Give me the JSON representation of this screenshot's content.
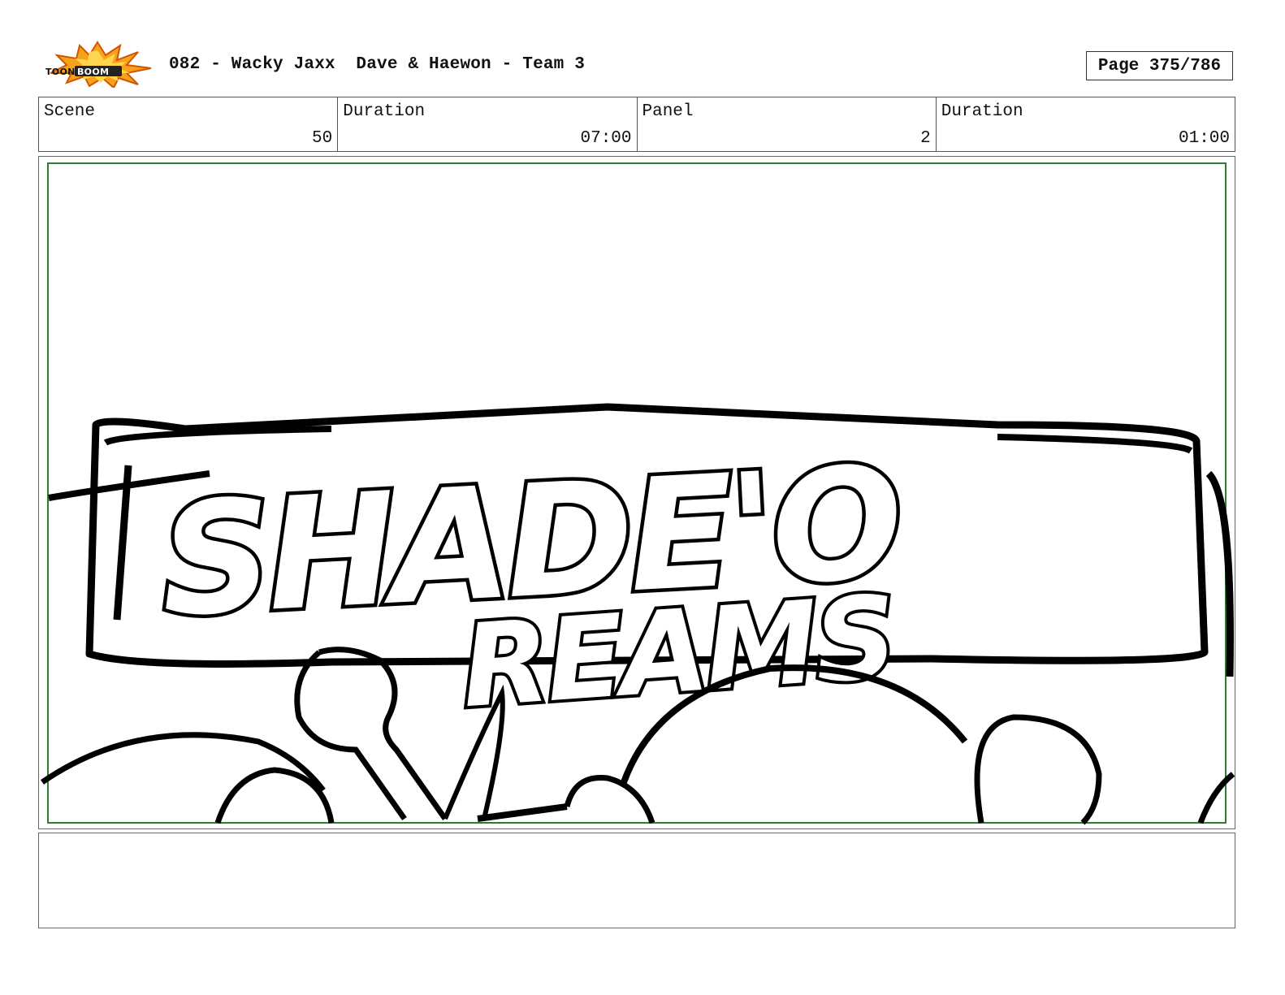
{
  "header": {
    "title": "082 - Wacky Jaxx  Dave & Haewon - Team 3",
    "page": "Page 375/786",
    "logo_text": "TOONBOOM"
  },
  "info": {
    "scene_label": "Scene",
    "scene_value": "50",
    "scene_duration_label": "Duration",
    "scene_duration_value": "07:00",
    "panel_label": "Panel",
    "panel_value": "2",
    "panel_duration_label": "Duration",
    "panel_duration_value": "01:00"
  },
  "panel": {
    "sign_line1": "SHADE'O",
    "sign_line2": "REAMS",
    "safe_frame_color": "#2e7d32"
  },
  "notes": {
    "text": ""
  }
}
